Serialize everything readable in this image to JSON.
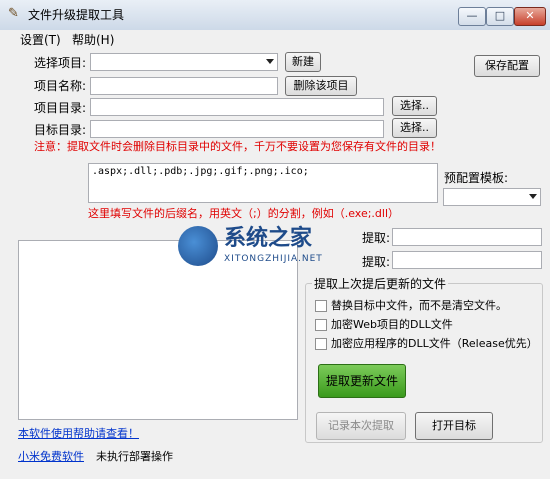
{
  "window": {
    "title": "文件升级提取工具",
    "min_glyph": "—",
    "max_glyph": "□",
    "close_glyph": "✕"
  },
  "menu": {
    "items": [
      {
        "label": "设置(T)"
      },
      {
        "label": "帮助(H)"
      }
    ]
  },
  "form": {
    "select_project_label": "选择项目:",
    "select_project_value": "",
    "new_button": "新建",
    "save_config_button": "保存配置",
    "project_name_label": "项目名称:",
    "project_name_value": "",
    "delete_project_button": "删除该项目",
    "project_dir_label": "项目目录:",
    "project_dir_value": "",
    "browse_button": "选择..",
    "target_dir_label": "目标目录:",
    "target_dir_value": "",
    "browse_button_2": "选择..",
    "warning": "注意：提取文件时会删除目标目录中的文件，千万不要设置为您保存有文件的目录！",
    "extensions_value": ".aspx;.dll;.pdb;.jpg;.gif;.png;.ico;",
    "preset_label": "预配置模板:",
    "preset_value": "",
    "extensions_hint": "这里填写文件的后缀名，用英文（;）的分割，例如（.exe;.dll）"
  },
  "right_panel": {
    "extract_label_1": "提取:",
    "extract_label_2": "提取:",
    "group_title": "提取上次提后更新的文件",
    "checkbox_replace": "替换目标中文件，而不是清空文件。",
    "checkbox_encrypt_web": "加密Web项目的DLL文件",
    "checkbox_encrypt_app": "加密应用程序的DLL文件（Release优先）",
    "extract_updated_button": "提取更新文件",
    "record_button": "记录本次提取",
    "open_target_button": "打开目标"
  },
  "footer": {
    "help_link": "本软件使用帮助请查看！",
    "brand_link": "小米免费软件",
    "status": "未执行部署操作"
  },
  "watermark": {
    "text": "系统之家",
    "sub": "XITONGZHIJIA.NET"
  },
  "colors": {
    "accent_green": "#3a9a1c",
    "warning_red": "#e00000",
    "link_blue": "#0033cc"
  }
}
